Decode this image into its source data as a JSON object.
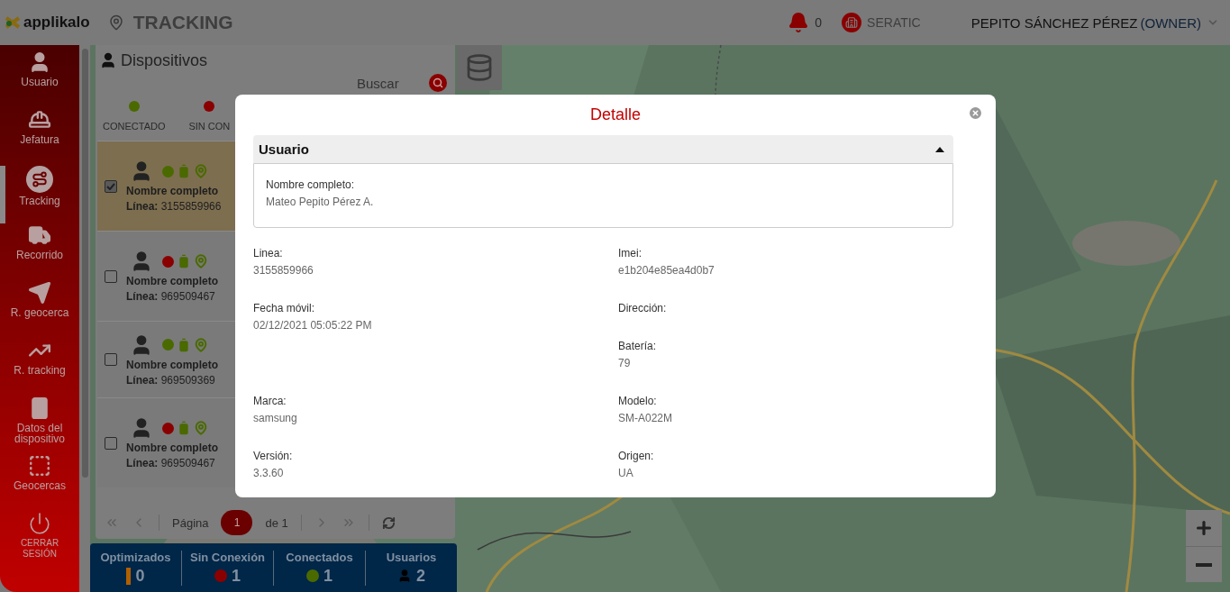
{
  "header": {
    "logo": "applikalo",
    "app_title": "TRACKING",
    "notifications": "0",
    "company": "SERATIC",
    "user": "PEPITO SÁNCHEZ PÉREZ",
    "role": "(OWNER)"
  },
  "sidebar": {
    "items": [
      {
        "label": "Usuario",
        "selected": false
      },
      {
        "label": "Jefatura",
        "selected": false
      },
      {
        "label": "Tracking",
        "selected": true
      },
      {
        "label": "Recorrido",
        "selected": false
      },
      {
        "label": "R. geocerca",
        "selected": false
      },
      {
        "label": "R. tracking",
        "selected": false
      },
      {
        "label": "Datos del dispositivo",
        "selected": false
      },
      {
        "label": "Geocercas",
        "selected": false
      },
      {
        "label": "CERRAR SESIÓN",
        "selected": false
      }
    ]
  },
  "devices": {
    "title": "Dispositivos",
    "search": {
      "placeholder": "Buscar"
    },
    "legend": [
      {
        "label": "CONECTADO",
        "color": "#4a6a00"
      },
      {
        "label": "SIN CON",
        "color": "#8a0000"
      }
    ],
    "rows": [
      {
        "name_label": "Nombre completo",
        "line_label": "Línea:",
        "line": "3155859966",
        "checked": true,
        "selected": true,
        "color": "#4a6a00"
      },
      {
        "name_label": "Nombre completo",
        "line_label": "Línea:",
        "line": "969509467",
        "checked": false,
        "selected": false,
        "color": "#8a0000"
      },
      {
        "name_label": "Nombre completo",
        "line_label": "Línea:",
        "line": "969509369",
        "checked": false,
        "selected": false,
        "color": "#4a6a00"
      },
      {
        "name_label": "Nombre completo",
        "line_label": "Línea:",
        "line": "969509467",
        "checked": false,
        "selected": false,
        "color": "#8a0000"
      }
    ],
    "pagination": {
      "page_label": "Página",
      "page": "1",
      "of_label": "de 1",
      "disabled": true
    }
  },
  "stats": [
    {
      "label": "Optimizados",
      "value": "0",
      "kind": "bar",
      "color": "#b06000"
    },
    {
      "label": "Sin Conexión",
      "value": "1",
      "kind": "dot",
      "color": "#8a0000"
    },
    {
      "label": "Conectados",
      "value": "1",
      "kind": "dot",
      "color": "#4a6a00"
    },
    {
      "label": "Usuarios",
      "value": "2",
      "kind": "user"
    }
  ],
  "modal": {
    "title": "Detalle",
    "section": {
      "title": "Usuario",
      "expanded": true,
      "fields": [
        {
          "label": "Nombre completo:",
          "value": "Mateo Pepito Pérez A."
        }
      ]
    },
    "rows": [
      {
        "left": {
          "label": "Linea:",
          "value": "3155859966"
        },
        "right": {
          "label": "Imei:",
          "value": "e1b204e85ea4d0b7"
        }
      },
      {
        "left": {
          "label": "Fecha móvil:",
          "value": "02/12/2021 05:05:22 PM"
        },
        "right": {
          "label": "Dirección:"
        }
      },
      {
        "right": {
          "label": "Batería:",
          "value": "79"
        }
      },
      {
        "left": {
          "label": "Marca:",
          "value": "samsung"
        },
        "right": {
          "label": "Modelo:",
          "value": "SM-A022M"
        }
      },
      {
        "left": {
          "label": "Versión:",
          "value": "3.3.60"
        },
        "right": {
          "label": "Origen:",
          "value": "UA"
        }
      }
    ]
  }
}
